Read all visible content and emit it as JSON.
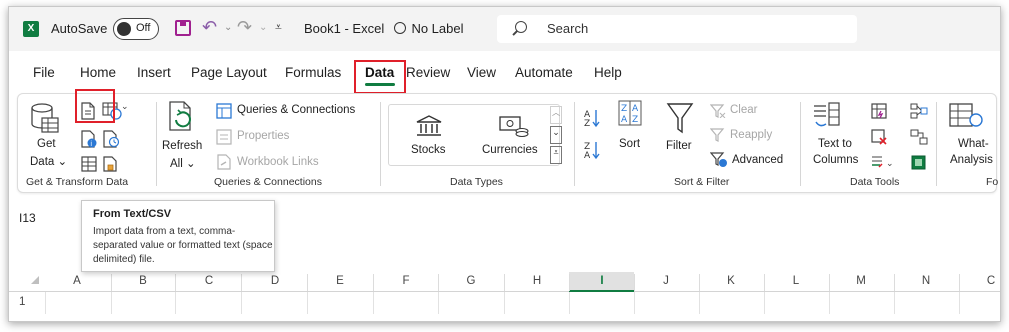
{
  "titlebar": {
    "app_logo": "X",
    "autosave_label": "AutoSave",
    "autosave_state": "Off",
    "book_title": "Book1 - Excel",
    "label_badge": "No Label",
    "search_placeholder": "Search"
  },
  "tabs": [
    "File",
    "Home",
    "Insert",
    "Page Layout",
    "Formulas",
    "Data",
    "Review",
    "View",
    "Automate",
    "Help"
  ],
  "active_tab": "Data",
  "ribbon": {
    "get_data": {
      "line1": "Get",
      "line2": "Data"
    },
    "group1_label": "Get & Transform Data",
    "refresh": {
      "line1": "Refresh",
      "line2": "All"
    },
    "queries_connections": "Queries & Connections",
    "properties": "Properties",
    "workbook_links": "Workbook Links",
    "group2_label": "Queries & Connections",
    "stocks": "Stocks",
    "currencies": "Currencies",
    "group3_label": "Data Types",
    "sort": "Sort",
    "filter": "Filter",
    "clear": "Clear",
    "reapply": "Reapply",
    "advanced": "Advanced",
    "group4_label": "Sort & Filter",
    "text_to_columns": {
      "line1": "Text to",
      "line2": "Columns"
    },
    "group5_label": "Data Tools",
    "what_if": {
      "line1": "What-",
      "line2": "Analysis"
    },
    "group6_label": "Fo"
  },
  "tooltip": {
    "title": "From Text/CSV",
    "description": "Import data from a text, comma-separated value or formatted text (space delimited) file."
  },
  "name_box": "I13",
  "columns": [
    "A",
    "B",
    "C",
    "D",
    "E",
    "F",
    "G",
    "H",
    "I",
    "J",
    "K",
    "L",
    "M",
    "N",
    "C"
  ],
  "active_column": "I",
  "rows": [
    "1"
  ],
  "colors": {
    "excel_green": "#107c41",
    "highlight_red": "#e0202a"
  }
}
